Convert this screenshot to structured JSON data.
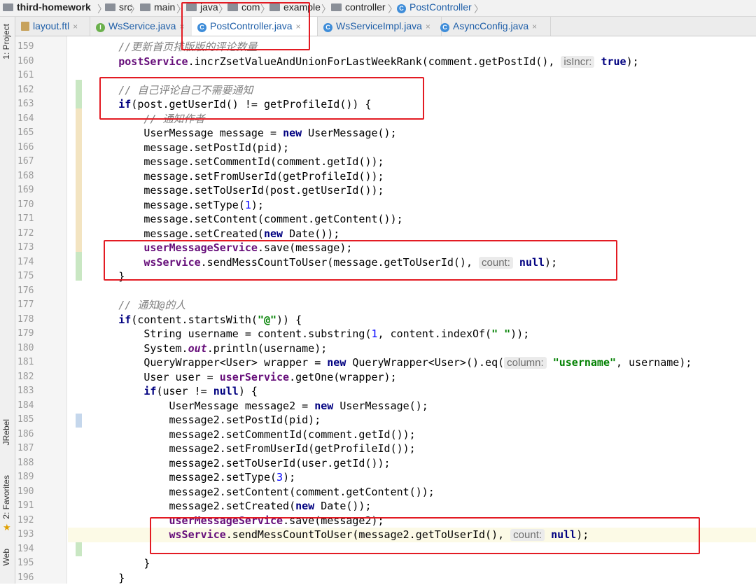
{
  "breadcrumbs": [
    {
      "label": "third-homework",
      "icon": "folder-icon",
      "bold": true
    },
    {
      "label": "src",
      "icon": "folder-icon"
    },
    {
      "label": "main",
      "icon": "folder-icon"
    },
    {
      "label": "java",
      "icon": "folder-icon"
    },
    {
      "label": "com",
      "icon": "folder-icon"
    },
    {
      "label": "example",
      "icon": "folder-icon"
    },
    {
      "label": "controller",
      "icon": "folder-icon"
    },
    {
      "label": "PostController",
      "icon": "class-icon"
    }
  ],
  "tabs": [
    {
      "label": "layout.ftl",
      "icon": "ftl-file-icon"
    },
    {
      "label": "WsService.java",
      "icon": "interface-icon"
    },
    {
      "label": "PostController.java",
      "icon": "class-icon",
      "active": true
    },
    {
      "label": "WsServiceImpl.java",
      "icon": "class-icon"
    },
    {
      "label": "AsyncConfig.java",
      "icon": "class-icon"
    }
  ],
  "close_glyph": "×",
  "tool_windows": {
    "project": "1: Project",
    "jrebel": "JRebel",
    "favorites": "2: Favorites",
    "web": "Web"
  },
  "line_numbers": [
    "159",
    "160",
    "161",
    "162",
    "163",
    "164",
    "165",
    "166",
    "167",
    "168",
    "169",
    "170",
    "171",
    "172",
    "173",
    "174",
    "175",
    "176",
    "177",
    "178",
    "179",
    "180",
    "181",
    "182",
    "183",
    "184",
    "185",
    "186",
    "187",
    "188",
    "189",
    "190",
    "191",
    "192",
    "193",
    "194",
    "195",
    "196"
  ],
  "code": {
    "l159": "//更新首页排版版的评论数量",
    "l160a": "postService",
    "l160b": ".incrZsetValueAndUnionForLastWeekRank(comment.getPostId(),",
    "l160hint": "isIncr:",
    "l160c": "true",
    "l162": "// 自己评论自己不需要通知",
    "l163a": "if",
    "l163b": "(post.getUserId() != getProfileId()) {",
    "l164": "// 通知作者",
    "l165a": "UserMessage message = ",
    "l165b": "new",
    "l165c": " UserMessage();",
    "l166": "message.setPostId(pid);",
    "l167": "message.setCommentId(comment.getId());",
    "l168": "message.setFromUserId(getProfileId());",
    "l169": "message.setToUserId(post.getUserId());",
    "l170a": "message.setType(",
    "l170n": "1",
    "l170b": ");",
    "l171": "message.setContent(comment.getContent());",
    "l172a": "message.setCreated(",
    "l172b": "new",
    "l172c": " Date());",
    "l173a": "userMessageService",
    "l173b": ".save(message);",
    "l174a": "wsService",
    "l174b": ".sendMessCountToUser(message.getToUserId(),",
    "l174hint": "count:",
    "l174c": "null",
    "l174d": ");",
    "l175": "}",
    "l177": "// 通知@的人",
    "l178a": "if",
    "l178b": "(content.startsWith(",
    "l178s": "\"@\"",
    "l178c": ")) {",
    "l179a": "String username = content.substring(",
    "l179n": "1",
    "l179b": ", content.indexOf(",
    "l179s": "\" \"",
    "l179c": "));",
    "l180a": "System.",
    "l180s": "out",
    "l180b": ".println(username);",
    "l181a": "QueryWrapper<User> wrapper = ",
    "l181b": "new",
    "l181c": " QueryWrapper<User>().eq(",
    "l181hint": "column:",
    "l181s": "\"username\"",
    "l181d": ", username);",
    "l182a": "User user = ",
    "l182b": "userService",
    "l182c": ".getOne(wrapper);",
    "l183a": "if",
    "l183b": "(user != ",
    "l183c": "null",
    "l183d": ") {",
    "l184a": "UserMessage message2 = ",
    "l184b": "new",
    "l184c": " UserMessage();",
    "l185": "message2.setPostId(pid);",
    "l186": "message2.setCommentId(comment.getId());",
    "l187": "message2.setFromUserId(getProfileId());",
    "l188": "message2.setToUserId(user.getId());",
    "l189a": "message2.setType(",
    "l189n": "3",
    "l189b": ");",
    "l190": "message2.setContent(comment.getContent());",
    "l191a": "message2.setCreated(",
    "l191b": "new",
    "l191c": " Date());",
    "l192a": "userMessageService",
    "l192b": ".save(message2);",
    "l193a": "wsService",
    "l193b": ".sendMessCountToUser(message2.getToUserId(),",
    "l193hint": "count:",
    "l193c": "null",
    "l193d": ");",
    "l195": "}",
    "l196": "}"
  },
  "colors": {
    "annotation_box": "#e31b23",
    "keyword": "#000080",
    "field": "#660e7a",
    "string": "#008000",
    "comment": "#808080",
    "current_line": "#fcfae6"
  }
}
